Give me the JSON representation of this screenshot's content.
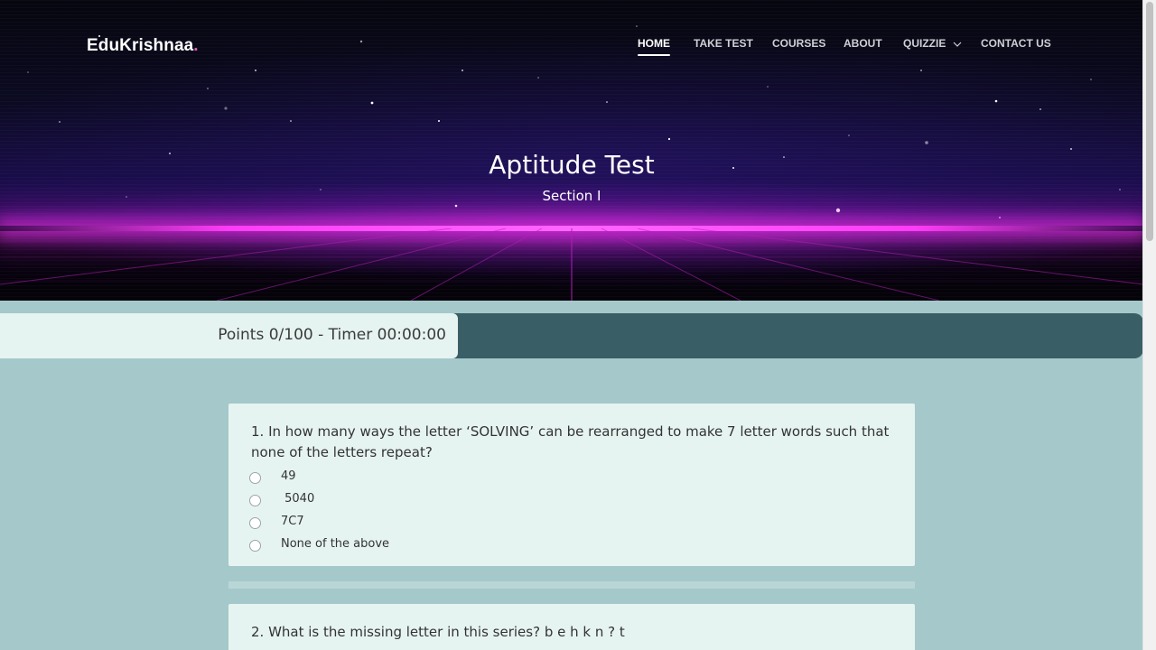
{
  "nav": {
    "brand": "EduKrishnaa",
    "brand_dot": ".",
    "items": [
      {
        "label": "HOME",
        "active": true
      },
      {
        "label": "TAKE TEST",
        "active": false
      },
      {
        "label": "COURSES",
        "active": false
      },
      {
        "label": "ABOUT",
        "active": false
      },
      {
        "label": "QUIZZIE",
        "active": false,
        "dropdown": true
      },
      {
        "label": "CONTACT US",
        "active": false
      }
    ]
  },
  "hero": {
    "title": "Aptitude Test",
    "subtitle": "Section I"
  },
  "status": {
    "text": "Points 0/100 - Timer 00:00:00"
  },
  "questions": [
    {
      "text": "1. In how many ways the letter ‘SOLVING’ can be rearranged to make 7 letter words such that none of the letters repeat?",
      "options": [
        "49",
        " 5040",
        "7C7",
        "None of the above"
      ]
    },
    {
      "text": "2. What is the missing letter in this series? b e h k n ? t",
      "options": []
    }
  ],
  "colors": {
    "page_bg": "#a5c8ca",
    "card_bg": "#e6f4f1",
    "points_bar": "#3a5e66",
    "horizon_glow": "#ff3cf6"
  },
  "icons": {
    "dropdown": "chevron-down-icon",
    "option_marker": "radio-circle"
  }
}
